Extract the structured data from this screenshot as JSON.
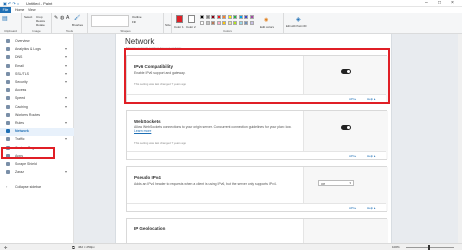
{
  "titlebar": {
    "title": "Untitled - Paint",
    "quick": "▣ ↶ ↷ ="
  },
  "ribbon_tabs": {
    "file": "File",
    "home": "Home",
    "view": "View"
  },
  "ribbon": {
    "select": "Select",
    "crop": "Crop",
    "resize": "Resize",
    "rotate": "Rotate",
    "brushes": "Brushes",
    "outline": "Outline",
    "fill": "Fill",
    "size": "Size",
    "color1": "Color 1",
    "color2": "Color 2",
    "edit_colors": "Edit colors",
    "paint3d": "Edit with Paint 3D",
    "group_clipboard": "Clipboard",
    "group_image": "Image",
    "group_tools": "Tools",
    "group_shapes": "Shapes",
    "group_colors": "Colors",
    "palette": [
      "#000000",
      "#7f7f7f",
      "#880015",
      "#ed1c24",
      "#ff7f27",
      "#fff200",
      "#22b14c",
      "#00a2e8",
      "#3f48cc",
      "#a349a4",
      "#ffffff",
      "#c3c3c3",
      "#b97a57",
      "#ffaec9",
      "#ffc90e",
      "#efe4b0",
      "#b5e61d",
      "#99d9ea",
      "#7092be",
      "#c8bfe7"
    ]
  },
  "sidebar": {
    "items": [
      {
        "label": "Overview",
        "chevron": ""
      },
      {
        "label": "Analytics & Logs",
        "chevron": "▾"
      },
      {
        "label": "DNS",
        "chevron": "▾"
      },
      {
        "label": "Email",
        "chevron": "▾"
      },
      {
        "label": "SSL/TLS",
        "chevron": "▾"
      },
      {
        "label": "Security",
        "chevron": "▾"
      },
      {
        "label": "Access",
        "chevron": ""
      },
      {
        "label": "Speed",
        "chevron": "▾"
      },
      {
        "label": "Caching",
        "chevron": "▾"
      },
      {
        "label": "Workers Routes",
        "chevron": ""
      },
      {
        "label": "Rules",
        "chevron": "▾"
      },
      {
        "label": "Network",
        "chevron": ""
      },
      {
        "label": "Traffic",
        "chevron": "▾"
      },
      {
        "label": "Custom Pages",
        "chevron": ""
      },
      {
        "label": "Apps",
        "chevron": ""
      },
      {
        "label": "Scrape Shield",
        "chevron": ""
      },
      {
        "label": "Zaraz",
        "chevron": "▾"
      }
    ],
    "collapse": "Collapse sidebar"
  },
  "main": {
    "title": "Network",
    "subtitle": "Manage network settings for your website.",
    "cards": [
      {
        "title": "IPv6 Compatibility",
        "desc": "Enable IPv6 support and gateway.",
        "note": "This setting was last changed 7 years ago",
        "api": "API ▸",
        "help": "Help ▸"
      },
      {
        "title": "WebSockets",
        "desc": "Allow WebSockets connections to your origin server. Concurrent connection guidelines for your plan: low.",
        "learn": "Learn more",
        "note": "This setting was last changed 7 years ago",
        "api": "API ▸",
        "help": "Help ▸"
      },
      {
        "title": "Pseudo IPv4",
        "desc": "Adds an IPv4 header to requests when a client is using IPv6, but the server only supports IPv4.",
        "select": "Off",
        "api": "API ▸",
        "help": "Help ▸"
      },
      {
        "title": "IP Geolocation"
      }
    ]
  },
  "statusbar": {
    "dims": "462 × 250px",
    "zoom": "100%"
  }
}
